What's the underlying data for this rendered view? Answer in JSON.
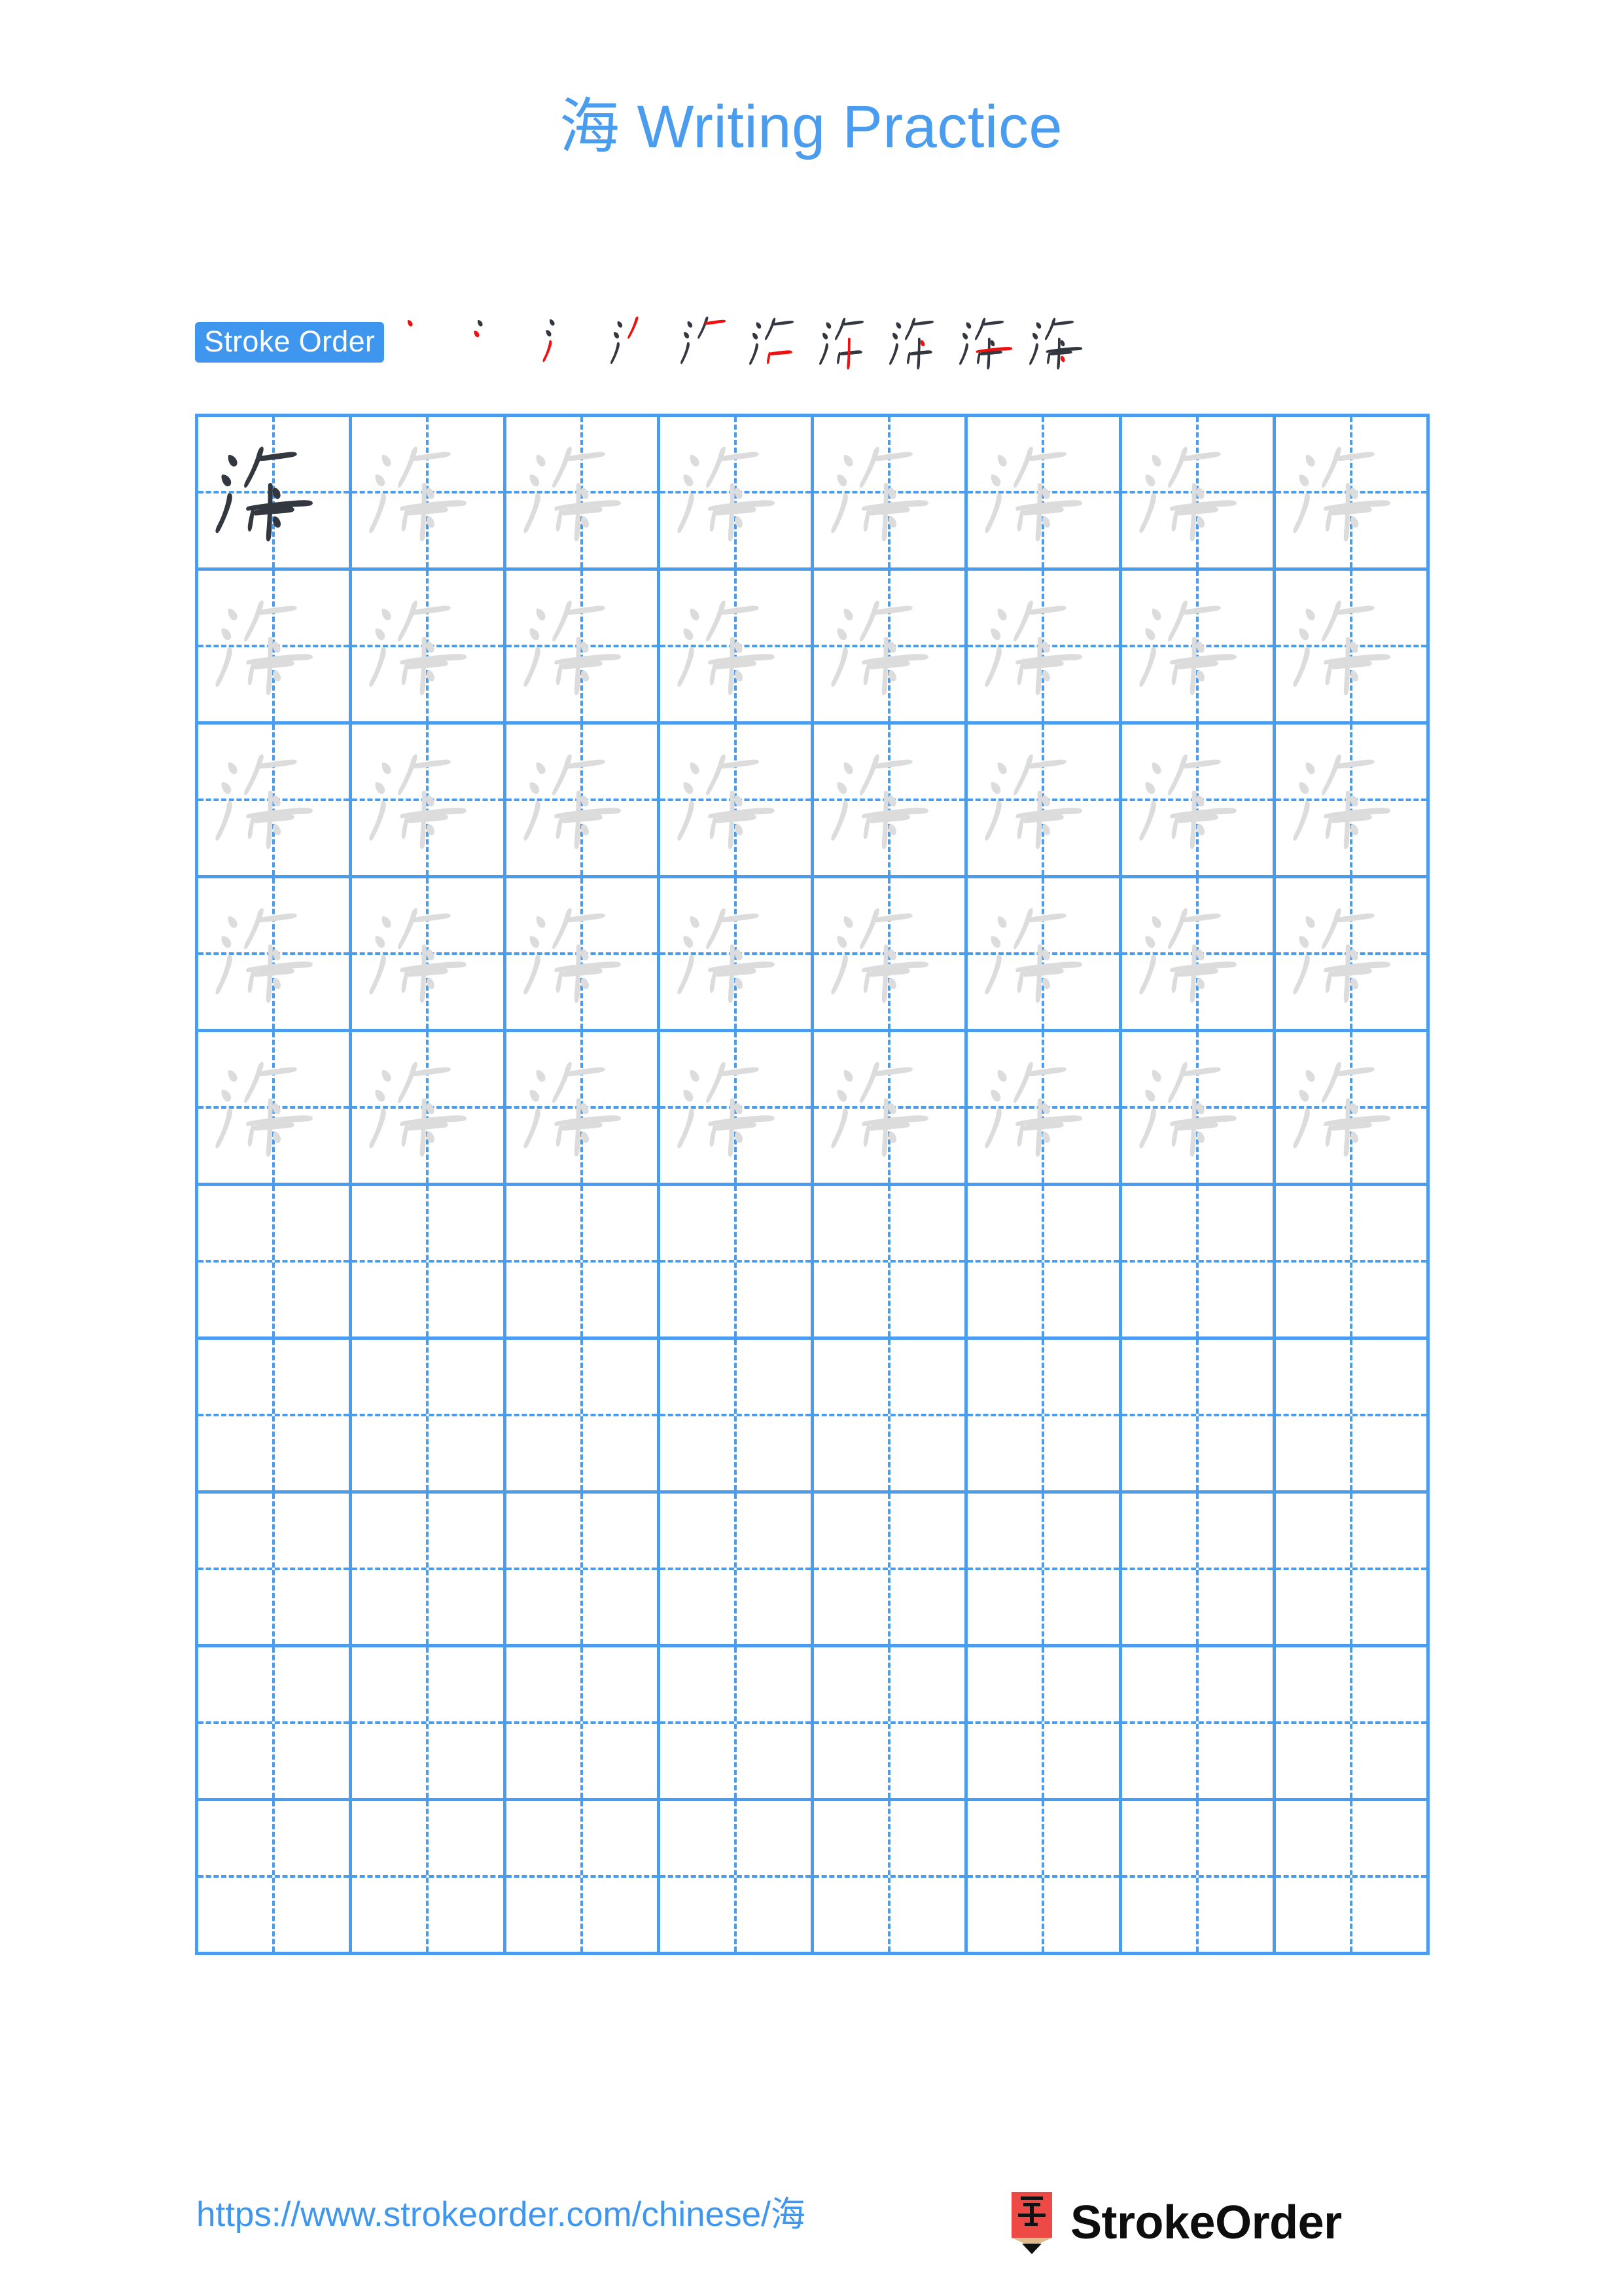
{
  "page": {
    "character": "海",
    "title_suffix": " Writing Practice",
    "title_full": "海 Writing Practice",
    "background_color": "#ffffff",
    "accent_blue": "#4a9cef",
    "badge_blue": "#3e96ee",
    "stroke_new_color": "#ee1111",
    "stroke_done_color": "#333840",
    "trace_gray": "#dcdcdc",
    "model_dark": "#333840"
  },
  "stroke_order": {
    "badge_label": "Stroke Order",
    "total_strokes": 10,
    "steps": [
      {
        "index": 1,
        "stroke_name": "dian",
        "new_stroke_color": "#ee1111"
      },
      {
        "index": 2,
        "stroke_name": "dian",
        "new_stroke_color": "#ee1111"
      },
      {
        "index": 3,
        "stroke_name": "ti",
        "new_stroke_color": "#ee1111"
      },
      {
        "index": 4,
        "stroke_name": "pie",
        "new_stroke_color": "#ee1111"
      },
      {
        "index": 5,
        "stroke_name": "heng",
        "new_stroke_color": "#ee1111"
      },
      {
        "index": 6,
        "stroke_name": "hengzhe-gou",
        "new_stroke_color": "#ee1111"
      },
      {
        "index": 7,
        "stroke_name": "shu-zhe",
        "new_stroke_color": "#ee1111"
      },
      {
        "index": 8,
        "stroke_name": "dian",
        "new_stroke_color": "#ee1111"
      },
      {
        "index": 9,
        "stroke_name": "heng",
        "new_stroke_color": "#ee1111"
      },
      {
        "index": 10,
        "stroke_name": "dian",
        "new_stroke_color": "#ee1111"
      }
    ]
  },
  "grid": {
    "columns": 8,
    "rows": 10,
    "filled_rows": 5,
    "empty_rows": 5,
    "model_cell": {
      "row": 1,
      "col": 1,
      "character": "海",
      "style": "model"
    },
    "trace_character": "海",
    "cells": [
      [
        "model",
        "trace",
        "trace",
        "trace",
        "trace",
        "trace",
        "trace",
        "trace"
      ],
      [
        "trace",
        "trace",
        "trace",
        "trace",
        "trace",
        "trace",
        "trace",
        "trace"
      ],
      [
        "trace",
        "trace",
        "trace",
        "trace",
        "trace",
        "trace",
        "trace",
        "trace"
      ],
      [
        "trace",
        "trace",
        "trace",
        "trace",
        "trace",
        "trace",
        "trace",
        "trace"
      ],
      [
        "trace",
        "trace",
        "trace",
        "trace",
        "trace",
        "trace",
        "trace",
        "trace"
      ],
      [
        "empty",
        "empty",
        "empty",
        "empty",
        "empty",
        "empty",
        "empty",
        "empty"
      ],
      [
        "empty",
        "empty",
        "empty",
        "empty",
        "empty",
        "empty",
        "empty",
        "empty"
      ],
      [
        "empty",
        "empty",
        "empty",
        "empty",
        "empty",
        "empty",
        "empty",
        "empty"
      ],
      [
        "empty",
        "empty",
        "empty",
        "empty",
        "empty",
        "empty",
        "empty",
        "empty"
      ],
      [
        "empty",
        "empty",
        "empty",
        "empty",
        "empty",
        "empty",
        "empty",
        "empty"
      ]
    ]
  },
  "footer": {
    "url_prefix": "https://www.strokeorder.com/chinese/",
    "url_char": "海",
    "url_full": "https://www.strokeorder.com/chinese/海",
    "brand_name": "StrokeOrder",
    "logo_char": "字",
    "logo_body_color": "#ee4a45",
    "logo_wood_color": "#e0b98c",
    "logo_tip_color": "#111111"
  }
}
